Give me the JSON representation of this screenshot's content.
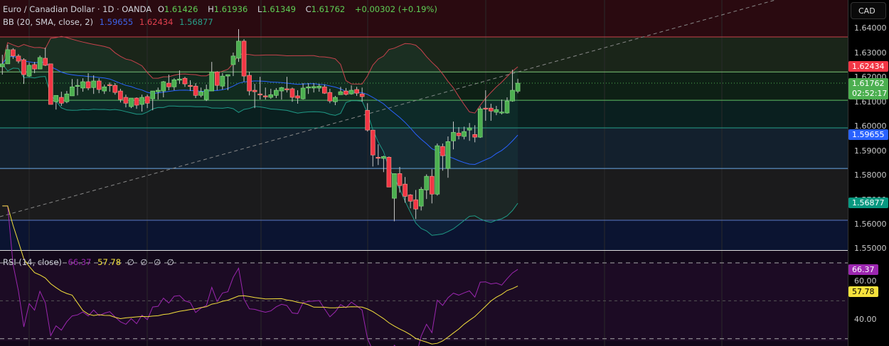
{
  "header": {
    "symbol": "Euro / Canadian Dollar · 1D · OANDA",
    "o_label": "O",
    "o": "1.61426",
    "h_label": "H",
    "h": "1.61936",
    "l_label": "L",
    "l": "1.61349",
    "c_label": "C",
    "c": "1.61762",
    "change": "+0.00302 (+0.19%)"
  },
  "bb": {
    "label": "BB (20, SMA, close, 2)",
    "basis": "1.59655",
    "upper": "1.62434",
    "lower": "1.56877"
  },
  "rsi": {
    "label": "RSI (14, close)",
    "value": "66.37",
    "ma": "57.78",
    "extra": [
      "∅",
      "∅",
      "∅",
      "∅"
    ]
  },
  "axis": {
    "currency": "CAD",
    "ticks": [
      "1.64000",
      "1.63000",
      "1.62000",
      "1.61000",
      "1.60000",
      "1.59000",
      "1.58000",
      "1.57000",
      "1.56000",
      "1.55000"
    ],
    "rsi_ticks": [
      "60.00",
      "40.00"
    ],
    "badges": {
      "upper": "1.62434",
      "close": "1.61762",
      "countdown": "02:52:17",
      "basis": "1.59655",
      "lower": "1.56877",
      "rsi": "66.37",
      "rsi_ma": "57.78"
    }
  },
  "colors": {
    "up": "#4caf50",
    "down": "#f23645",
    "basis": "#2962ff",
    "upper": "#c8424c",
    "lower": "#1f9a86",
    "rsi": "#9c27b0",
    "rsi_ma": "#f5e13c"
  },
  "chart_data": {
    "type": "candlestick",
    "price_range": [
      1.55,
      1.64
    ],
    "rsi_range": [
      30,
      70
    ],
    "horizontal_levels": [
      1.6365,
      1.6222,
      1.6106,
      1.5993,
      1.5827,
      1.5615
    ],
    "ohlc": [
      [
        1.6243,
        1.6292,
        1.6211,
        1.6255
      ],
      [
        1.6255,
        1.6333,
        1.6255,
        1.6313
      ],
      [
        1.6313,
        1.6319,
        1.6275,
        1.6287
      ],
      [
        1.6287,
        1.6295,
        1.6257,
        1.6266
      ],
      [
        1.6272,
        1.6278,
        1.6173,
        1.6211
      ],
      [
        1.6205,
        1.626,
        1.6202,
        1.6249
      ],
      [
        1.6252,
        1.6263,
        1.6217,
        1.6234
      ],
      [
        1.6234,
        1.6289,
        1.6234,
        1.6281
      ],
      [
        1.6278,
        1.6321,
        1.6246,
        1.6249
      ],
      [
        1.6255,
        1.6255,
        1.6089,
        1.6089
      ],
      [
        1.61,
        1.6126,
        1.6068,
        1.6126
      ],
      [
        1.6118,
        1.6141,
        1.6083,
        1.6094
      ],
      [
        1.61,
        1.6144,
        1.6094,
        1.6132
      ],
      [
        1.6124,
        1.6193,
        1.6124,
        1.6161
      ],
      [
        1.6167,
        1.6193,
        1.6126,
        1.6167
      ],
      [
        1.6156,
        1.6196,
        1.6141,
        1.6182
      ],
      [
        1.6182,
        1.6217,
        1.6147,
        1.6156
      ],
      [
        1.6158,
        1.6208,
        1.6132,
        1.6185
      ],
      [
        1.6185,
        1.6196,
        1.6135,
        1.615
      ],
      [
        1.6144,
        1.617,
        1.6132,
        1.6161
      ],
      [
        1.617,
        1.6179,
        1.6141,
        1.6168
      ],
      [
        1.6167,
        1.6176,
        1.6129,
        1.6138
      ],
      [
        1.6144,
        1.6153,
        1.6097,
        1.6109
      ],
      [
        1.6118,
        1.6129,
        1.6077,
        1.6094
      ],
      [
        1.608,
        1.6115,
        1.6074,
        1.6115
      ],
      [
        1.6115,
        1.6118,
        1.6071,
        1.6086
      ],
      [
        1.6089,
        1.6129,
        1.606,
        1.6118
      ],
      [
        1.6121,
        1.6129,
        1.6074,
        1.6094
      ],
      [
        1.6112,
        1.6144,
        1.6065,
        1.6144
      ],
      [
        1.6141,
        1.6158,
        1.6109,
        1.6147
      ],
      [
        1.6144,
        1.6185,
        1.6118,
        1.6182
      ],
      [
        1.6176,
        1.6211,
        1.6147,
        1.6161
      ],
      [
        1.6161,
        1.6196,
        1.6147,
        1.619
      ],
      [
        1.6188,
        1.6228,
        1.6173,
        1.6193
      ],
      [
        1.6196,
        1.6202,
        1.6161,
        1.6173
      ],
      [
        1.6167,
        1.6188,
        1.6144,
        1.6166
      ],
      [
        1.6164,
        1.6176,
        1.6115,
        1.6126
      ],
      [
        1.6126,
        1.6158,
        1.6118,
        1.6141
      ],
      [
        1.6109,
        1.617,
        1.6103,
        1.615
      ],
      [
        1.6144,
        1.6263,
        1.6144,
        1.6222
      ],
      [
        1.6222,
        1.6225,
        1.6147,
        1.6167
      ],
      [
        1.6164,
        1.6217,
        1.615,
        1.6205
      ],
      [
        1.6205,
        1.6211,
        1.6147,
        1.6211
      ],
      [
        1.6252,
        1.6301,
        1.6205,
        1.6287
      ],
      [
        1.6278,
        1.6397,
        1.6263,
        1.6348
      ],
      [
        1.6348,
        1.6356,
        1.6182,
        1.6205
      ],
      [
        1.6208,
        1.6222,
        1.6126,
        1.6144
      ],
      [
        1.6147,
        1.6173,
        1.6074,
        1.6141
      ],
      [
        1.6132,
        1.6202,
        1.6109,
        1.6131
      ],
      [
        1.6124,
        1.6158,
        1.6109,
        1.6123
      ],
      [
        1.6118,
        1.6153,
        1.6112,
        1.6129
      ],
      [
        1.6126,
        1.6156,
        1.6115,
        1.6147
      ],
      [
        1.6144,
        1.6161,
        1.6109,
        1.6158
      ],
      [
        1.6153,
        1.6202,
        1.6138,
        1.6152
      ],
      [
        1.6153,
        1.6158,
        1.61,
        1.6118
      ],
      [
        1.6124,
        1.6147,
        1.6092,
        1.6115
      ],
      [
        1.6112,
        1.6176,
        1.6109,
        1.6156
      ],
      [
        1.6156,
        1.6176,
        1.6132,
        1.6161
      ],
      [
        1.6156,
        1.6176,
        1.6138,
        1.6162
      ],
      [
        1.6156,
        1.6173,
        1.6141,
        1.6164
      ],
      [
        1.6161,
        1.617,
        1.6132,
        1.6135
      ],
      [
        1.6138,
        1.6153,
        1.6094,
        1.6103
      ],
      [
        1.61,
        1.6124,
        1.6086,
        1.6118
      ],
      [
        1.6129,
        1.6161,
        1.6129,
        1.6141
      ],
      [
        1.6144,
        1.6156,
        1.6126,
        1.613
      ],
      [
        1.6132,
        1.6167,
        1.6129,
        1.6147
      ],
      [
        1.615,
        1.6161,
        1.6124,
        1.6135
      ],
      [
        1.6132,
        1.6158,
        1.61,
        1.6121
      ],
      [
        1.6065,
        1.6094,
        1.5978,
        1.5984
      ],
      [
        1.5984,
        1.5984,
        1.5835,
        1.5882
      ],
      [
        1.5873,
        1.5926,
        1.5841,
        1.5872
      ],
      [
        1.5868,
        1.5879,
        1.5812,
        1.5876
      ],
      [
        1.5873,
        1.5876,
        1.5751,
        1.5751
      ],
      [
        1.5705,
        1.5806,
        1.5611,
        1.5806
      ],
      [
        1.5806,
        1.5833,
        1.5728,
        1.5757
      ],
      [
        1.5763,
        1.5792,
        1.5687,
        1.5713
      ],
      [
        1.5719,
        1.5722,
        1.5664,
        1.5693
      ],
      [
        1.5699,
        1.5739,
        1.562,
        1.5661
      ],
      [
        1.5673,
        1.5751,
        1.5655,
        1.5742
      ],
      [
        1.5739,
        1.5803,
        1.5702,
        1.5795
      ],
      [
        1.5795,
        1.5824,
        1.5684,
        1.5722
      ],
      [
        1.5722,
        1.5929,
        1.5716,
        1.592
      ],
      [
        1.5917,
        1.5929,
        1.5818,
        1.5879
      ],
      [
        1.5827,
        1.5958,
        1.5789,
        1.5937
      ],
      [
        1.594,
        1.6019,
        1.5905,
        1.5975
      ],
      [
        1.5972,
        1.5996,
        1.5946,
        1.5961
      ],
      [
        1.5958,
        1.5998,
        1.5946,
        1.5978
      ],
      [
        1.5984,
        1.6013,
        1.594,
        1.5993
      ],
      [
        1.5966,
        1.6004,
        1.5934,
        1.5955
      ],
      [
        1.5955,
        1.608,
        1.5952,
        1.6071
      ],
      [
        1.6074,
        1.6147,
        1.6022,
        1.6073
      ],
      [
        1.6074,
        1.6092,
        1.6022,
        1.6062
      ],
      [
        1.6057,
        1.6083,
        1.6045,
        1.6068
      ],
      [
        1.6057,
        1.6109,
        1.6048,
        1.6058
      ],
      [
        1.6054,
        1.6118,
        1.6051,
        1.6103
      ],
      [
        1.6103,
        1.6231,
        1.61,
        1.6147
      ],
      [
        1.6143,
        1.6194,
        1.6135,
        1.6176
      ]
    ]
  }
}
